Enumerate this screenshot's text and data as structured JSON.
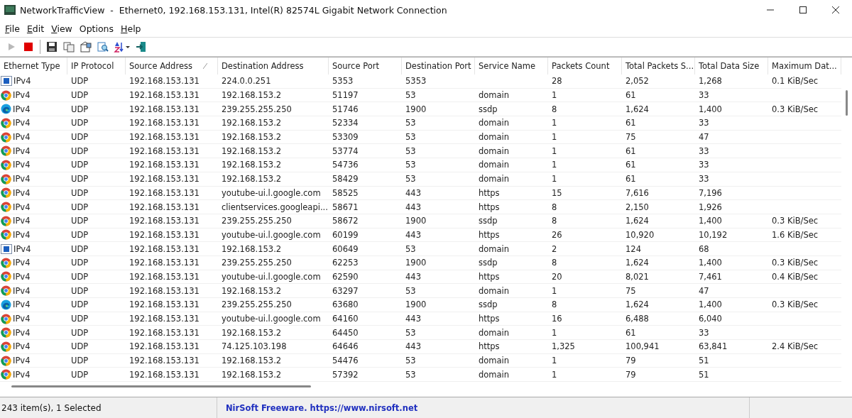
{
  "window": {
    "title": "NetworkTrafficView  -  Ethernet0, 192.168.153.131, Intel(R) 82574L Gigabit Network Connection"
  },
  "menu": [
    {
      "label": "File",
      "underlined": true
    },
    {
      "label": "Edit",
      "underlined": true
    },
    {
      "label": "View",
      "underlined": true
    },
    {
      "label": "Options",
      "underlined": false
    },
    {
      "label": "Help",
      "underlined": true
    }
  ],
  "toolbar": [
    {
      "kind": "play",
      "disabled": true
    },
    {
      "kind": "stop",
      "disabled": false
    },
    {
      "kind": "separator"
    },
    {
      "kind": "save",
      "disabled": false
    },
    {
      "kind": "copy",
      "disabled": false
    },
    {
      "kind": "properties",
      "disabled": false
    },
    {
      "kind": "find",
      "disabled": false
    },
    {
      "kind": "sort",
      "disabled": false
    },
    {
      "kind": "exit",
      "disabled": false
    }
  ],
  "table": {
    "columns": [
      {
        "label": "Ethernet Type",
        "sorted": false
      },
      {
        "label": "IP Protocol",
        "sorted": false
      },
      {
        "label": "Source Address",
        "sorted": true
      },
      {
        "label": "Destination Address",
        "sorted": false
      },
      {
        "label": "Source Port",
        "sorted": false
      },
      {
        "label": "Destination Port",
        "sorted": false
      },
      {
        "label": "Service Name",
        "sorted": false
      },
      {
        "label": "Packets Count",
        "sorted": false
      },
      {
        "label": "Total Packets S...",
        "sorted": false
      },
      {
        "label": "Total Data Size",
        "sorted": false
      },
      {
        "label": "Maximum Dat...",
        "sorted": false
      }
    ],
    "rows": [
      {
        "kind": "app",
        "cells": [
          "IPv4",
          "UDP",
          "192.168.153.131",
          "224.0.0.251",
          "5353",
          "5353",
          "",
          "28",
          "2,052",
          "1,268",
          "0.1 KiB/Sec"
        ]
      },
      {
        "kind": "chrome",
        "cells": [
          "IPv4",
          "UDP",
          "192.168.153.131",
          "192.168.153.2",
          "51197",
          "53",
          "domain",
          "1",
          "61",
          "33",
          ""
        ]
      },
      {
        "kind": "edge",
        "cells": [
          "IPv4",
          "UDP",
          "192.168.153.131",
          "239.255.255.250",
          "51746",
          "1900",
          "ssdp",
          "8",
          "1,624",
          "1,400",
          "0.3 KiB/Sec"
        ]
      },
      {
        "kind": "chrome",
        "cells": [
          "IPv4",
          "UDP",
          "192.168.153.131",
          "192.168.153.2",
          "52334",
          "53",
          "domain",
          "1",
          "61",
          "33",
          ""
        ]
      },
      {
        "kind": "chrome",
        "cells": [
          "IPv4",
          "UDP",
          "192.168.153.131",
          "192.168.153.2",
          "53309",
          "53",
          "domain",
          "1",
          "75",
          "47",
          ""
        ]
      },
      {
        "kind": "chrome",
        "cells": [
          "IPv4",
          "UDP",
          "192.168.153.131",
          "192.168.153.2",
          "53774",
          "53",
          "domain",
          "1",
          "61",
          "33",
          ""
        ]
      },
      {
        "kind": "chrome",
        "cells": [
          "IPv4",
          "UDP",
          "192.168.153.131",
          "192.168.153.2",
          "54736",
          "53",
          "domain",
          "1",
          "61",
          "33",
          ""
        ]
      },
      {
        "kind": "chrome",
        "cells": [
          "IPv4",
          "UDP",
          "192.168.153.131",
          "192.168.153.2",
          "58429",
          "53",
          "domain",
          "1",
          "61",
          "33",
          ""
        ]
      },
      {
        "kind": "chrome",
        "cells": [
          "IPv4",
          "UDP",
          "192.168.153.131",
          "youtube-ui.l.google.com",
          "58525",
          "443",
          "https",
          "15",
          "7,616",
          "7,196",
          ""
        ]
      },
      {
        "kind": "chrome",
        "cells": [
          "IPv4",
          "UDP",
          "192.168.153.131",
          "clientservices.googleapi...",
          "58671",
          "443",
          "https",
          "8",
          "2,150",
          "1,926",
          ""
        ]
      },
      {
        "kind": "chrome",
        "cells": [
          "IPv4",
          "UDP",
          "192.168.153.131",
          "239.255.255.250",
          "58672",
          "1900",
          "ssdp",
          "8",
          "1,624",
          "1,400",
          "0.3 KiB/Sec"
        ]
      },
      {
        "kind": "chrome",
        "cells": [
          "IPv4",
          "UDP",
          "192.168.153.131",
          "youtube-ui.l.google.com",
          "60199",
          "443",
          "https",
          "26",
          "10,920",
          "10,192",
          "1.6 KiB/Sec"
        ]
      },
      {
        "kind": "app",
        "cells": [
          "IPv4",
          "UDP",
          "192.168.153.131",
          "192.168.153.2",
          "60649",
          "53",
          "domain",
          "2",
          "124",
          "68",
          ""
        ]
      },
      {
        "kind": "chrome",
        "cells": [
          "IPv4",
          "UDP",
          "192.168.153.131",
          "239.255.255.250",
          "62253",
          "1900",
          "ssdp",
          "8",
          "1,624",
          "1,400",
          "0.3 KiB/Sec"
        ]
      },
      {
        "kind": "chrome",
        "cells": [
          "IPv4",
          "UDP",
          "192.168.153.131",
          "youtube-ui.l.google.com",
          "62590",
          "443",
          "https",
          "20",
          "8,021",
          "7,461",
          "0.4 KiB/Sec"
        ]
      },
      {
        "kind": "chrome",
        "cells": [
          "IPv4",
          "UDP",
          "192.168.153.131",
          "192.168.153.2",
          "63297",
          "53",
          "domain",
          "1",
          "75",
          "47",
          ""
        ]
      },
      {
        "kind": "edge",
        "cells": [
          "IPv4",
          "UDP",
          "192.168.153.131",
          "239.255.255.250",
          "63680",
          "1900",
          "ssdp",
          "8",
          "1,624",
          "1,400",
          "0.3 KiB/Sec"
        ]
      },
      {
        "kind": "chrome",
        "cells": [
          "IPv4",
          "UDP",
          "192.168.153.131",
          "youtube-ui.l.google.com",
          "64160",
          "443",
          "https",
          "16",
          "6,488",
          "6,040",
          ""
        ]
      },
      {
        "kind": "chrome",
        "cells": [
          "IPv4",
          "UDP",
          "192.168.153.131",
          "192.168.153.2",
          "64450",
          "53",
          "domain",
          "1",
          "61",
          "33",
          ""
        ]
      },
      {
        "kind": "chrome",
        "cells": [
          "IPv4",
          "UDP",
          "192.168.153.131",
          "74.125.103.198",
          "64646",
          "443",
          "https",
          "1,325",
          "100,941",
          "63,841",
          "2.4 KiB/Sec"
        ]
      },
      {
        "kind": "chrome",
        "cells": [
          "IPv4",
          "UDP",
          "192.168.153.131",
          "192.168.153.2",
          "54476",
          "53",
          "domain",
          "1",
          "79",
          "51",
          ""
        ]
      },
      {
        "kind": "chrome",
        "cells": [
          "IPv4",
          "UDP",
          "192.168.153.131",
          "192.168.153.2",
          "57392",
          "53",
          "domain",
          "1",
          "79",
          "51",
          ""
        ]
      }
    ]
  },
  "status_bar": {
    "count": "243 item(s), 1 Selected",
    "credit": "NirSoft Freeware. https://www.nirsoft.net"
  }
}
